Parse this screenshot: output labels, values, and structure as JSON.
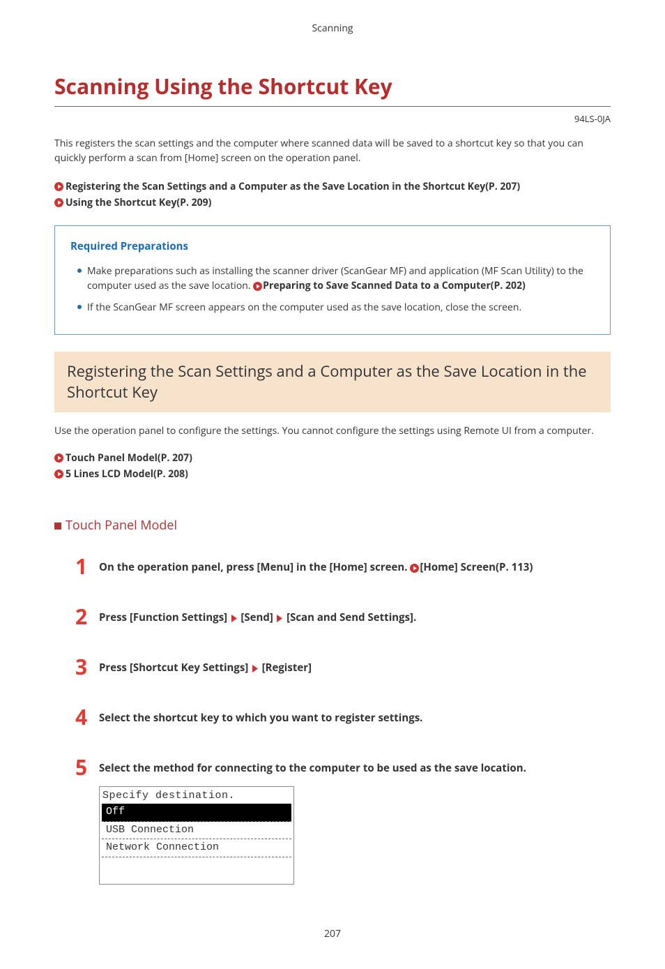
{
  "header_label": "Scanning",
  "title": "Scanning Using the Shortcut Key",
  "doc_code": "94LS-0JA",
  "intro": "This registers the scan settings and the computer where scanned data will be saved to a shortcut key so that you can quickly perform a scan from [Home] screen on the operation panel.",
  "top_links": [
    "Registering the Scan Settings and a Computer as the Save Location in the Shortcut Key(P. 207)",
    "Using the Shortcut Key(P. 209)"
  ],
  "prep_box": {
    "title": "Required Preparations",
    "items": [
      {
        "prefix": "Make preparations such as installing the scanner driver (ScanGear MF) and application (MF Scan Utility) to the computer used as the save location. ",
        "link": "Preparing to Save Scanned Data to a Computer(P. 202)"
      },
      {
        "prefix": "If the ScanGear MF screen appears on the computer used as the save location, close the screen.",
        "link": ""
      }
    ]
  },
  "section_banner": "Registering the Scan Settings and a Computer as the Save Location in the Shortcut Key",
  "section_intro": "Use the operation panel to configure the settings. You cannot configure the settings using Remote UI from a computer.",
  "section_links": [
    "Touch Panel Model(P. 207)",
    "5 Lines LCD Model(P. 208)"
  ],
  "sub_heading": "Touch Panel Model",
  "steps": {
    "s1": {
      "prefix": "On the operation panel, press [Menu] in the [Home] screen. ",
      "link": "[Home] Screen(P. 113)"
    },
    "s2": {
      "parts": [
        "Press [Function Settings]",
        "[Send]",
        "[Scan and Send Settings]."
      ]
    },
    "s3": {
      "parts": [
        "Press [Shortcut Key Settings]",
        "[Register]"
      ]
    },
    "s4": "Select the shortcut key to which you want to register settings.",
    "s5": "Select the method for connecting to the computer to be used as the save location."
  },
  "screenshot": {
    "title": "Specify destination.",
    "options": [
      "Off",
      "USB Connection",
      "Network Connection"
    ],
    "selected_index": 0
  },
  "page_number": "207"
}
